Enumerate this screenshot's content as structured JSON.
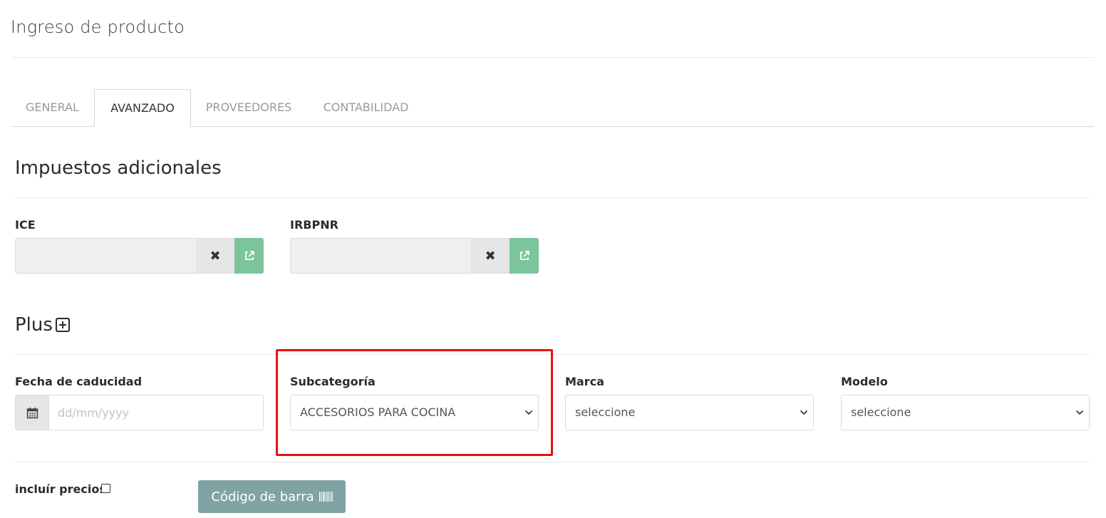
{
  "page": {
    "title": "Ingreso de producto"
  },
  "tabs": [
    {
      "label": "GENERAL"
    },
    {
      "label": "AVANZADO"
    },
    {
      "label": "PROVEEDORES"
    },
    {
      "label": "CONTABILIDAD"
    }
  ],
  "active_tab": "AVANZADO",
  "taxes": {
    "title": "Impuestos adicionales",
    "ice_label": "ICE",
    "irbpnr_label": "IRBPNR",
    "ice_value": "",
    "irbpnr_value": "",
    "clear_icon": "close-icon",
    "open_icon": "external-link-icon"
  },
  "plus": {
    "title": "Plus",
    "expiry_label": "Fecha de caducidad",
    "expiry_placeholder": "dd/mm/yyyy",
    "expiry_value": "",
    "subcategory_label": "Subcategoría",
    "subcategory_value": "ACCESORIOS PARA COCINA",
    "brand_label": "Marca",
    "brand_value": "seleccione",
    "model_label": "Modelo",
    "model_value": "seleccione",
    "include_prices_label": "incluír precios",
    "include_prices_checked": false,
    "barcode_button_label": "Código de barra"
  },
  "colors": {
    "open_button": "#7cc49a",
    "barcode_button": "#7fa3a4",
    "highlight": "#e81010"
  }
}
